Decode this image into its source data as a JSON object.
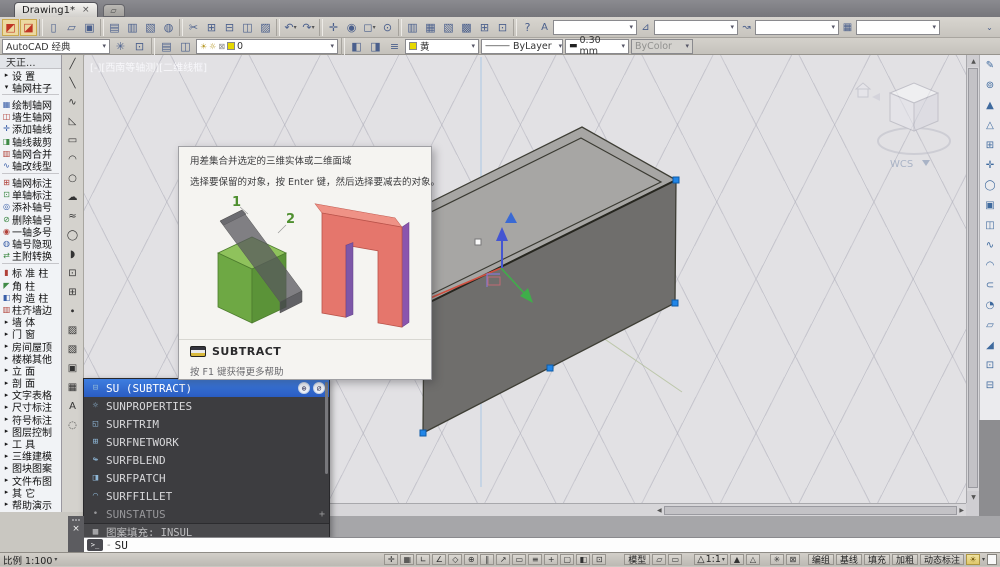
{
  "tabbar": {
    "tab": "Drawing1*",
    "close": "×",
    "newtab_icon": "▱"
  },
  "toolbar1": {
    "buttons": [
      {
        "g": "◩",
        "cls": "red"
      },
      {
        "g": "◪",
        "cls": "red"
      },
      {
        "cls": "sep"
      },
      {
        "g": "▯"
      },
      {
        "g": "▱"
      },
      {
        "g": "▣"
      },
      {
        "cls": "sep"
      },
      {
        "g": "▤"
      },
      {
        "g": "▥"
      },
      {
        "g": "▧"
      },
      {
        "g": "◍"
      },
      {
        "cls": "sep"
      },
      {
        "g": "✂"
      },
      {
        "g": "⊞"
      },
      {
        "g": "⊟"
      },
      {
        "g": "◫"
      },
      {
        "g": "▨"
      },
      {
        "cls": "sep"
      },
      {
        "g": "↶",
        "cls": "dd"
      },
      {
        "g": "↷",
        "cls": "dd"
      },
      {
        "cls": "sep"
      },
      {
        "g": "✛"
      },
      {
        "g": "◉"
      },
      {
        "g": "◻",
        "cls": "dd"
      },
      {
        "g": "⊙"
      },
      {
        "cls": "sep"
      },
      {
        "g": "▥"
      },
      {
        "g": "▦"
      },
      {
        "g": "▧"
      },
      {
        "g": "▩"
      },
      {
        "g": "⊞"
      },
      {
        "g": "⊡"
      },
      {
        "cls": "sep"
      },
      {
        "g": "?"
      }
    ],
    "style_combos": [
      {
        "icon": "A"
      },
      {
        "icon": "⊿"
      },
      {
        "icon": "↝"
      },
      {
        "icon": "▦"
      }
    ],
    "overflow": "⌄"
  },
  "toolbar2": {
    "workspace": "AutoCAD 经典",
    "ws_icons": [
      "✳",
      "⊡"
    ],
    "layer_icons": [
      "▤",
      "◫"
    ],
    "layer": {
      "bulb": "☀",
      "sun": "☼",
      "lock": "⊠",
      "name": "0"
    },
    "tool_icons": [
      "◧",
      "◨",
      "≡"
    ],
    "color_label": "黄",
    "linetype_sample": "———",
    "linetype_label": "ByLayer",
    "lineweight_sample": "▬",
    "lineweight_label": "0.30 mm",
    "plotstyle_label": "ByColor"
  },
  "sidebar": {
    "items": [
      {
        "label": "天正...",
        "cls": "hdr"
      },
      {
        "label": "设  置",
        "icon": "▸",
        "cls": "grp"
      },
      {
        "label": "轴网柱子",
        "icon": "▾",
        "cls": "grp"
      },
      {
        "cls": "sep"
      },
      {
        "label": "绘制轴网",
        "icon": "▦",
        "cls": "c1"
      },
      {
        "label": "墙生轴网",
        "icon": "◫",
        "cls": "c2"
      },
      {
        "label": "添加轴线",
        "icon": "✛",
        "cls": "c1"
      },
      {
        "label": "轴线裁剪",
        "icon": "◨",
        "cls": "c3"
      },
      {
        "label": "轴网合并",
        "icon": "▥",
        "cls": "c2"
      },
      {
        "label": "轴改线型",
        "icon": "∿",
        "cls": "c1"
      },
      {
        "cls": "sep"
      },
      {
        "label": "轴网标注",
        "icon": "⊞",
        "cls": "c2"
      },
      {
        "label": "单轴标注",
        "icon": "⊡",
        "cls": "c3"
      },
      {
        "label": "添补轴号",
        "icon": "◎",
        "cls": "c1"
      },
      {
        "label": "删除轴号",
        "icon": "⊘",
        "cls": "c3"
      },
      {
        "label": "一轴多号",
        "icon": "◉",
        "cls": "c2"
      },
      {
        "label": "轴号隐现",
        "icon": "◍",
        "cls": "c1"
      },
      {
        "label": "主附转换",
        "icon": "⇄",
        "cls": "c3"
      },
      {
        "cls": "sep"
      },
      {
        "label": "标 准 柱",
        "icon": "▮",
        "cls": "c2"
      },
      {
        "label": "角  柱",
        "icon": "◤",
        "cls": "c3"
      },
      {
        "label": "构 造 柱",
        "icon": "◧",
        "cls": "c1"
      },
      {
        "label": "柱齐墙边",
        "icon": "▥",
        "cls": "c2"
      },
      {
        "label": "墙  体",
        "icon": "▸",
        "cls": "grp"
      },
      {
        "label": "门  窗",
        "icon": "▸",
        "cls": "grp"
      },
      {
        "label": "房间屋顶",
        "icon": "▸",
        "cls": "grp"
      },
      {
        "label": "楼梯其他",
        "icon": "▸",
        "cls": "grp"
      },
      {
        "label": "立  面",
        "icon": "▸",
        "cls": "grp"
      },
      {
        "label": "剖  面",
        "icon": "▸",
        "cls": "grp"
      },
      {
        "label": "文字表格",
        "icon": "▸",
        "cls": "grp"
      },
      {
        "label": "尺寸标注",
        "icon": "▸",
        "cls": "grp"
      },
      {
        "label": "符号标注",
        "icon": "▸",
        "cls": "grp"
      },
      {
        "label": "图层控制",
        "icon": "▸",
        "cls": "grp"
      },
      {
        "label": "工  具",
        "icon": "▸",
        "cls": "grp"
      },
      {
        "label": "三维建模",
        "icon": "▸",
        "cls": "grp"
      },
      {
        "label": "图块图案",
        "icon": "▸",
        "cls": "grp"
      },
      {
        "label": "文件布图",
        "icon": "▸",
        "cls": "grp"
      },
      {
        "label": "其  它",
        "icon": "▸",
        "cls": "grp"
      },
      {
        "label": "帮助演示",
        "icon": "▸",
        "cls": "grp"
      }
    ]
  },
  "drawtb": {
    "icons": [
      "╱",
      "╲",
      "∿",
      "◺",
      "▭",
      "◠",
      "○",
      "☁",
      "≈",
      "◯",
      "◗",
      "⊡",
      "⊞",
      "∙",
      "▨",
      "▧",
      "▣",
      "▦",
      "A",
      "◌"
    ]
  },
  "rstrip": {
    "icons": [
      "✎",
      "⊚",
      "▲",
      "△",
      "⊞",
      "✛",
      "◯",
      "▣",
      "◫",
      "∿",
      "◠",
      "⊂",
      "◔",
      "▱",
      "◢",
      "⊡",
      "⊟"
    ]
  },
  "viewport": {
    "label": "[-][西南等轴测][二维线框]",
    "wcs": "WCS"
  },
  "tooltip": {
    "line1": "用差集合并选定的三维实体或二维面域",
    "line2": "选择要保留的对象，按 Enter 键，然后选择要减去的对象。",
    "fig_label1": "1",
    "fig_label2": "2",
    "command": "SUBTRACT",
    "help": "按 F1 键获得更多帮助"
  },
  "autocomplete": {
    "globe": "⊕",
    "magnifier": "⌀",
    "plus": "+",
    "items": [
      {
        "label": "SU (SUBTRACT)",
        "glyph": "⊟",
        "cls": "active"
      },
      {
        "label": "SUNPROPERTIES",
        "glyph": "☼"
      },
      {
        "label": "SURFTRIM",
        "glyph": "◱"
      },
      {
        "label": "SURFNETWORK",
        "glyph": "⊞"
      },
      {
        "label": "SURFBLEND",
        "glyph": "↬"
      },
      {
        "label": "SURFPATCH",
        "glyph": "◨"
      },
      {
        "label": "SURFFILLET",
        "glyph": "◠"
      },
      {
        "label": "SUNSTATUS",
        "glyph": "•",
        "cls": "dim"
      },
      {
        "label": "图案填充: INSUL",
        "glyph": "▦",
        "cls": "hatch"
      }
    ]
  },
  "cmdline": {
    "prompt": ">_",
    "dash": "-",
    "value": "SU"
  },
  "statusbar": {
    "scale": "比例 1:100",
    "icons": [
      "✛",
      "▦",
      "∟",
      "∠",
      "◇",
      "⊕",
      "∥",
      "↗",
      "▭",
      "≡",
      "+",
      "▢",
      "◧",
      "⊡"
    ],
    "model": "模型",
    "model_icons": [
      "▱",
      "▭"
    ],
    "anno_icon": "△",
    "anno_scale": "1:1",
    "anno_icons": [
      "▲",
      "△"
    ],
    "sys_icons": [
      "✳",
      "⊠"
    ],
    "toggles": [
      "编组",
      "基线",
      "填充",
      "加粗",
      "动态标注"
    ],
    "bulb": "☀",
    "caret": "▾"
  },
  "colors": {
    "highlight_blue": "#2f6fd8",
    "viewport_bg": "#e2e1e4",
    "list_bg": "#3d3d40",
    "box_top": "#a7a6a4",
    "box_front": "#6f6e6c",
    "fig_green": "#8fc25c",
    "fig_red": "#e5766c",
    "fig_purple": "#7d57a8",
    "layer_yellow": "#e6d800"
  }
}
